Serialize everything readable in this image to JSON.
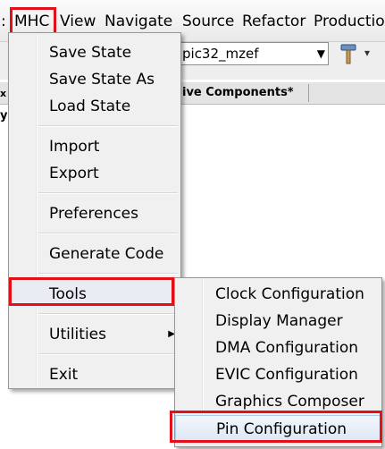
{
  "menubar": {
    "separator": ":",
    "items": [
      "MHC",
      "View",
      "Navigate",
      "Source",
      "Refactor",
      "Productio"
    ]
  },
  "toolbar": {
    "config_combo_value": "pic32_mzef",
    "combo_arrow": "▼",
    "hammer_icon": "hammer-icon"
  },
  "tabs": {
    "active_components_label": "ive Components*"
  },
  "left_panel": {
    "close_glyph": "x",
    "stub_text": "y"
  },
  "mhc_menu": {
    "items": [
      {
        "label": "Save State"
      },
      {
        "label": "Save State As"
      },
      {
        "label": "Load State"
      },
      {
        "label": "Import"
      },
      {
        "label": "Export"
      },
      {
        "label": "Preferences"
      },
      {
        "label": "Generate Code"
      },
      {
        "label": "Tools"
      },
      {
        "label": "Utilities"
      },
      {
        "label": "Exit"
      }
    ],
    "submenu_arrow": "▶"
  },
  "tools_submenu": {
    "items": [
      {
        "label": "Clock Configuration"
      },
      {
        "label": "Display Manager"
      },
      {
        "label": "DMA Configuration"
      },
      {
        "label": "EVIC Configuration"
      },
      {
        "label": "Graphics Composer"
      },
      {
        "label": "Pin Configuration"
      }
    ]
  },
  "colors": {
    "highlight_box": "#e3101a",
    "menu_bg": "#f0f0f0",
    "selected_item": "#dde7f5"
  }
}
